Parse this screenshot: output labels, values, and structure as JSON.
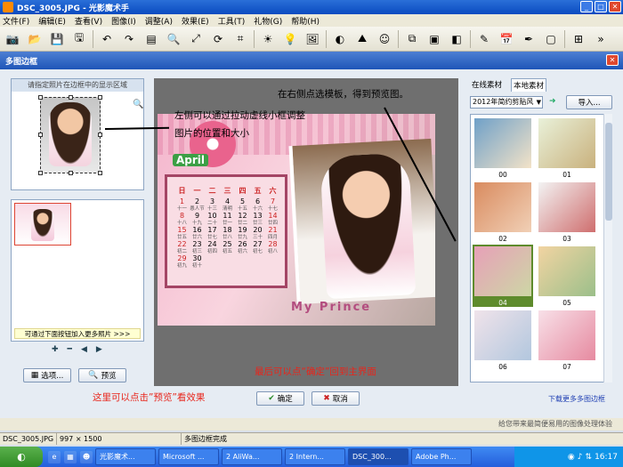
{
  "window": {
    "title": "DSC_3005.JPG - 光影魔术手"
  },
  "menu": [
    "文件(F)",
    "编辑(E)",
    "查看(V)",
    "图像(I)",
    "调整(A)",
    "效果(E)",
    "工具(T)",
    "礼物(G)",
    "帮助(H)"
  ],
  "dialog": {
    "title": "多图边框",
    "hint_text": "请指定照片在边框中的显示区域",
    "add_more_text": "可通过下面按钮加入更多照片 >>>",
    "options_button": "选项...",
    "preview_button": "预览",
    "ok_button": "确定",
    "cancel_button": "取消",
    "tabs": [
      "在线素材",
      "本地素材"
    ],
    "category": "2012年简约剪贴风",
    "import_button": "导入...",
    "download_link": "下载更多多图边框",
    "templates": [
      "00",
      "01",
      "02",
      "03",
      "04",
      "05",
      "06",
      "07"
    ],
    "selected_template": "04"
  },
  "poster": {
    "month": "April",
    "weekdays": [
      "日",
      "一",
      "二",
      "三",
      "四",
      "五",
      "六"
    ],
    "days": [
      [
        "1",
        "2",
        "3",
        "4",
        "5",
        "6",
        "7"
      ],
      [
        "8",
        "9",
        "10",
        "11",
        "12",
        "13",
        "14"
      ],
      [
        "15",
        "16",
        "17",
        "18",
        "19",
        "20",
        "21"
      ],
      [
        "22",
        "23",
        "24",
        "25",
        "26",
        "27",
        "28"
      ],
      [
        "29",
        "30",
        "",
        "",
        "",
        "",
        ""
      ]
    ],
    "lunar": [
      [
        "十一",
        "愚人节",
        "十三",
        "清明",
        "十五",
        "十六",
        "十七"
      ],
      [
        "十八",
        "十九",
        "二十",
        "廿一",
        "廿二",
        "廿三",
        "廿四"
      ],
      [
        "廿五",
        "廿六",
        "廿七",
        "廿八",
        "廿九",
        "三十",
        "四月"
      ],
      [
        "初二",
        "初三",
        "初四",
        "初五",
        "初六",
        "初七",
        "初八"
      ],
      [
        "初九",
        "初十",
        "",
        "",
        "",
        "",
        ""
      ]
    ],
    "caption": "My Prince"
  },
  "annotations": {
    "top": "在右侧点选模板，得到预览图。",
    "left_1": "左侧可以通过拉动虚线小框调整",
    "left_2": "图片的位置和大小",
    "bottom": "最后可以点“确定”回到主界面",
    "preview_hint": "这里可以点击”预览”看效果"
  },
  "tip_bar": "给您带来最简便易用的图像处理体验",
  "status": [
    "DSC_3005.JPG",
    "997 × 1500",
    "多图边框完成"
  ],
  "taskbar": {
    "tasks": [
      "光影魔术...",
      "Microsoft ...",
      "2 AliWa...",
      "2 Intern...",
      "DSC_300...",
      "Adobe Ph..."
    ],
    "active_task": "DSC_300...",
    "clock": "16:17"
  },
  "colors": {
    "annotation_red": "#e8251b",
    "selected_template": "#5e8b2c"
  }
}
